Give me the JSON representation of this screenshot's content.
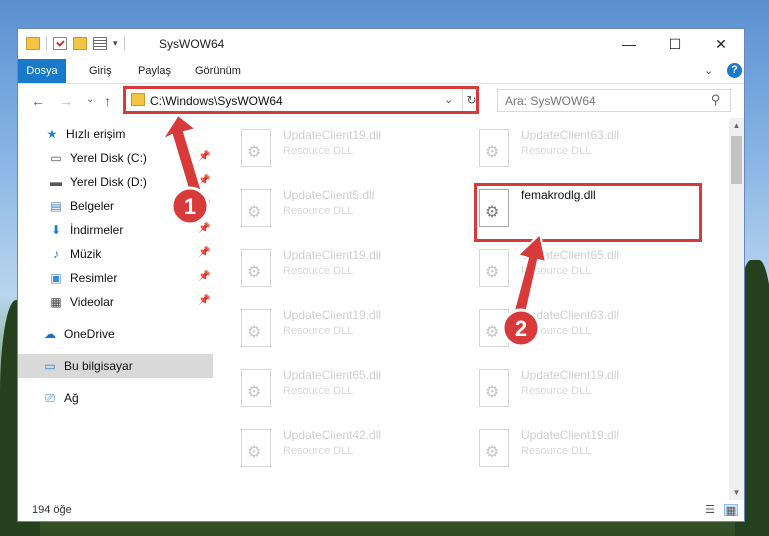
{
  "window": {
    "title": "SysWOW64",
    "minimize_glyph": "—",
    "maximize_glyph": "☐",
    "close_glyph": "✕"
  },
  "ribbon": {
    "tabs": [
      "Dosya",
      "Giriş",
      "Paylaş",
      "Görünüm"
    ],
    "help_glyph": "?",
    "collapse_glyph": "⌄"
  },
  "navigation": {
    "back_glyph": "←",
    "forward_glyph": "→",
    "recent_glyph": "⌄",
    "up_glyph": "↑",
    "address": "C:\\Windows\\SysWOW64",
    "address_dropdown_glyph": "⌄",
    "refresh_glyph": "↻",
    "search_placeholder": "Ara: SysWOW64",
    "search_glyph": "⚲"
  },
  "sidebar": {
    "items": [
      {
        "label": "Hızlı erişim",
        "icon": "star-icon",
        "glyph": "★",
        "color": "#1e7fd6",
        "pinned": false
      },
      {
        "label": "Yerel Disk (C:)",
        "icon": "drive-icon",
        "glyph": "▭",
        "color": "#555555",
        "pinned": true
      },
      {
        "label": "Yerel Disk (D:)",
        "icon": "drive-icon",
        "glyph": "▬",
        "color": "#555555",
        "pinned": true
      },
      {
        "label": "Belgeler",
        "icon": "documents-icon",
        "glyph": "▤",
        "color": "#4a78b5",
        "pinned": true
      },
      {
        "label": "İndirmeler",
        "icon": "download-icon",
        "glyph": "⬇",
        "color": "#1e7fd6",
        "pinned": true
      },
      {
        "label": "Müzik",
        "icon": "music-icon",
        "glyph": "♪",
        "color": "#1e7fd6",
        "pinned": true
      },
      {
        "label": "Resimler",
        "icon": "pictures-icon",
        "glyph": "▣",
        "color": "#3a8ad0",
        "pinned": true
      },
      {
        "label": "Videolar",
        "icon": "video-icon",
        "glyph": "▦",
        "color": "#444444",
        "pinned": true
      },
      {
        "label": "OneDrive",
        "icon": "cloud-icon",
        "glyph": "☁",
        "color": "#1e6fc6",
        "pinned": false
      },
      {
        "label": "Bu bilgisayar",
        "icon": "computer-icon",
        "glyph": "▭",
        "color": "#2f86d4",
        "pinned": false
      },
      {
        "label": "Ağ",
        "icon": "network-icon",
        "glyph": "⎚",
        "color": "#2f86d4",
        "pinned": false
      }
    ],
    "pin_glyph": "📌"
  },
  "files": [
    {
      "name": "UpdateClient19.dll",
      "type": "Resource DLL"
    },
    {
      "name": "UpdateClient63.dll",
      "type": "Resource DLL"
    },
    {
      "name": "UpdateClient5.dll",
      "type": "Resource DLL"
    },
    {
      "name": "femakrodlg.dll",
      "type": ""
    },
    {
      "name": "UpdateClient19.dll",
      "type": "Resource DLL"
    },
    {
      "name": "UpdateClient65.dll",
      "type": "Resource DLL"
    },
    {
      "name": "UpdateClient19.dll",
      "type": "Resource DLL"
    },
    {
      "name": "UpdateClient63.dll",
      "type": "Resource DLL"
    },
    {
      "name": "UpdateClient65.dll",
      "type": "Resource DLL"
    },
    {
      "name": "UpdateClient19.dll",
      "type": "Resource DLL"
    },
    {
      "name": "UpdateClient42.dll",
      "type": "Resource DLL"
    },
    {
      "name": "UpdateClient19.dll",
      "type": "Resource DLL"
    }
  ],
  "annotations": {
    "step1": "1",
    "step2": "2",
    "accent_color": "#d83a3a"
  },
  "status": {
    "item_count": "194 öğe",
    "details_view_glyph": "☰",
    "icons_view_glyph": "▦"
  }
}
